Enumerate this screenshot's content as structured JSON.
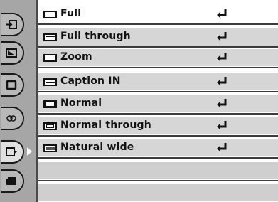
{
  "menu": {
    "items": [
      {
        "label": "Full",
        "icon": "full-screen-icon",
        "selected": true
      },
      {
        "label": "Full through",
        "icon": "full-through-icon",
        "selected": false
      },
      {
        "label": "Zoom",
        "icon": "zoom-screen-icon",
        "selected": false
      },
      {
        "label": "Caption IN",
        "icon": "caption-in-icon",
        "selected": false
      },
      {
        "label": "Normal",
        "icon": "normal-screen-icon",
        "selected": false
      },
      {
        "label": "Normal through",
        "icon": "normal-through-icon",
        "selected": false
      },
      {
        "label": "Natural wide",
        "icon": "natural-wide-icon",
        "selected": false
      }
    ],
    "enter_icon": "enter-return-icon"
  },
  "tabs": [
    {
      "icon": "input-icon",
      "active": false
    },
    {
      "icon": "image-adjust-icon",
      "active": false
    },
    {
      "icon": "pc-adjust-icon",
      "active": false
    },
    {
      "icon": "image-select-icon",
      "active": false
    },
    {
      "icon": "screen-icon",
      "active": true
    },
    {
      "icon": "setting-icon",
      "active": false
    }
  ],
  "colors": {
    "row": "#d6d6d6",
    "row_selected": "#ffffff",
    "tab_column": "#a6a6a6",
    "text": "#111111"
  }
}
